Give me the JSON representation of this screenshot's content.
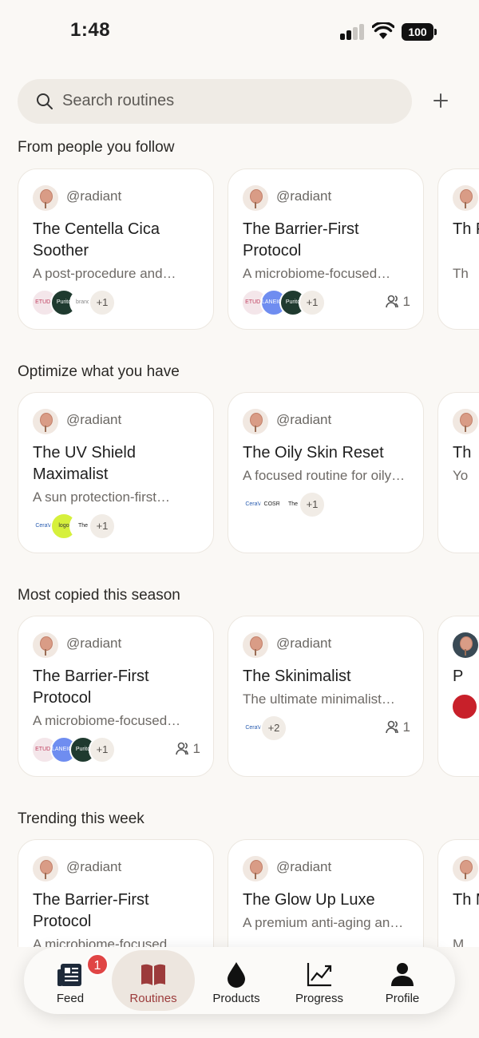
{
  "status_bar": {
    "time": "1:48",
    "battery": "100"
  },
  "search": {
    "placeholder": "Search routines"
  },
  "sections": [
    {
      "title": "From people you follow",
      "cards": [
        {
          "handle": "@radiant",
          "title": "The Centella Cica Soother",
          "desc": "A post-procedure and…",
          "chips": [
            "ETUDE",
            "Purito",
            "brand"
          ],
          "more": "+1",
          "copies": ""
        },
        {
          "handle": "@radiant",
          "title": "The Barrier-First Protocol",
          "desc": "A microbiome-focused…",
          "chips": [
            "ETUDE",
            "LANEIGE",
            "Purito"
          ],
          "more": "+1",
          "copies": "1"
        },
        {
          "handle": "",
          "title": "Th P",
          "desc": "Th",
          "chips": [],
          "more": "",
          "copies": ""
        }
      ]
    },
    {
      "title": "Optimize what you have",
      "cards": [
        {
          "handle": "@radiant",
          "title": "The UV Shield Maximalist",
          "desc": "A sun protection-first…",
          "chips": [
            "CeraVe",
            "logo",
            "The Ordinary"
          ],
          "more": "+1",
          "copies": ""
        },
        {
          "handle": "@radiant",
          "title": "The Oily Skin Reset",
          "desc": "A focused routine for oily…",
          "chips": [
            "CeraVe",
            "COSRX",
            "The Ordinary"
          ],
          "more": "+1",
          "copies": ""
        },
        {
          "handle": "",
          "title": "Th",
          "desc": "Yo",
          "chips": [],
          "more": "",
          "copies": ""
        }
      ]
    },
    {
      "title": "Most copied this season",
      "cards": [
        {
          "handle": "@radiant",
          "title": "The Barrier-First Protocol",
          "desc": "A microbiome-focused…",
          "chips": [
            "ETUDE",
            "LANEIGE",
            "Purito"
          ],
          "more": "+1",
          "copies": "1"
        },
        {
          "handle": "@radiant",
          "title": "The Skinimalist",
          "desc": "The ultimate minimalist…",
          "chips": [
            "CeraVe"
          ],
          "more": "+2",
          "copies": "1"
        },
        {
          "handle": "",
          "title": "P",
          "desc": "",
          "chips": [],
          "more": "",
          "copies": ""
        }
      ]
    },
    {
      "title": "Trending this week",
      "cards": [
        {
          "handle": "@radiant",
          "title": "The Barrier-First Protocol",
          "desc": "A microbiome-focused…",
          "chips": [],
          "more": "",
          "copies": ""
        },
        {
          "handle": "@radiant",
          "title": "The Glow Up Luxe",
          "desc": "A premium anti-aging an…",
          "chips": [],
          "more": "",
          "copies": ""
        },
        {
          "handle": "",
          "title": "Th M",
          "desc": "M",
          "chips": [],
          "more": "",
          "copies": ""
        }
      ]
    }
  ],
  "tabs": [
    {
      "label": "Feed",
      "icon": "feed-icon",
      "badge": "1"
    },
    {
      "label": "Routines",
      "icon": "book-icon"
    },
    {
      "label": "Products",
      "icon": "drop-icon"
    },
    {
      "label": "Progress",
      "icon": "chart-icon"
    },
    {
      "label": "Profile",
      "icon": "person-icon"
    }
  ],
  "colors": {
    "accent": "#9c3b3b",
    "background": "#faf8f5",
    "badge": "#e04545"
  }
}
